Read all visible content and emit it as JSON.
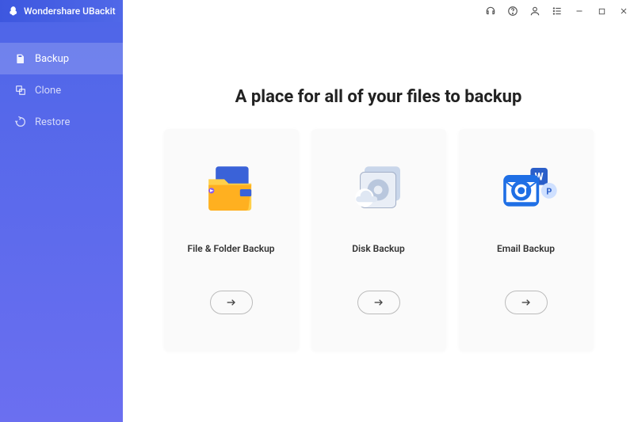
{
  "app": {
    "name": "Wondershare UBackit"
  },
  "sidebar": {
    "items": [
      {
        "label": "Backup",
        "icon": "backup-icon",
        "active": true
      },
      {
        "label": "Clone",
        "icon": "clone-icon",
        "active": false
      },
      {
        "label": "Restore",
        "icon": "restore-icon",
        "active": false
      }
    ]
  },
  "main": {
    "title": "A place for all of your files to backup",
    "cards": [
      {
        "label": "File & Folder Backup",
        "illustration": "folder"
      },
      {
        "label": "Disk Backup",
        "illustration": "disk"
      },
      {
        "label": "Email Backup",
        "illustration": "email"
      }
    ]
  }
}
